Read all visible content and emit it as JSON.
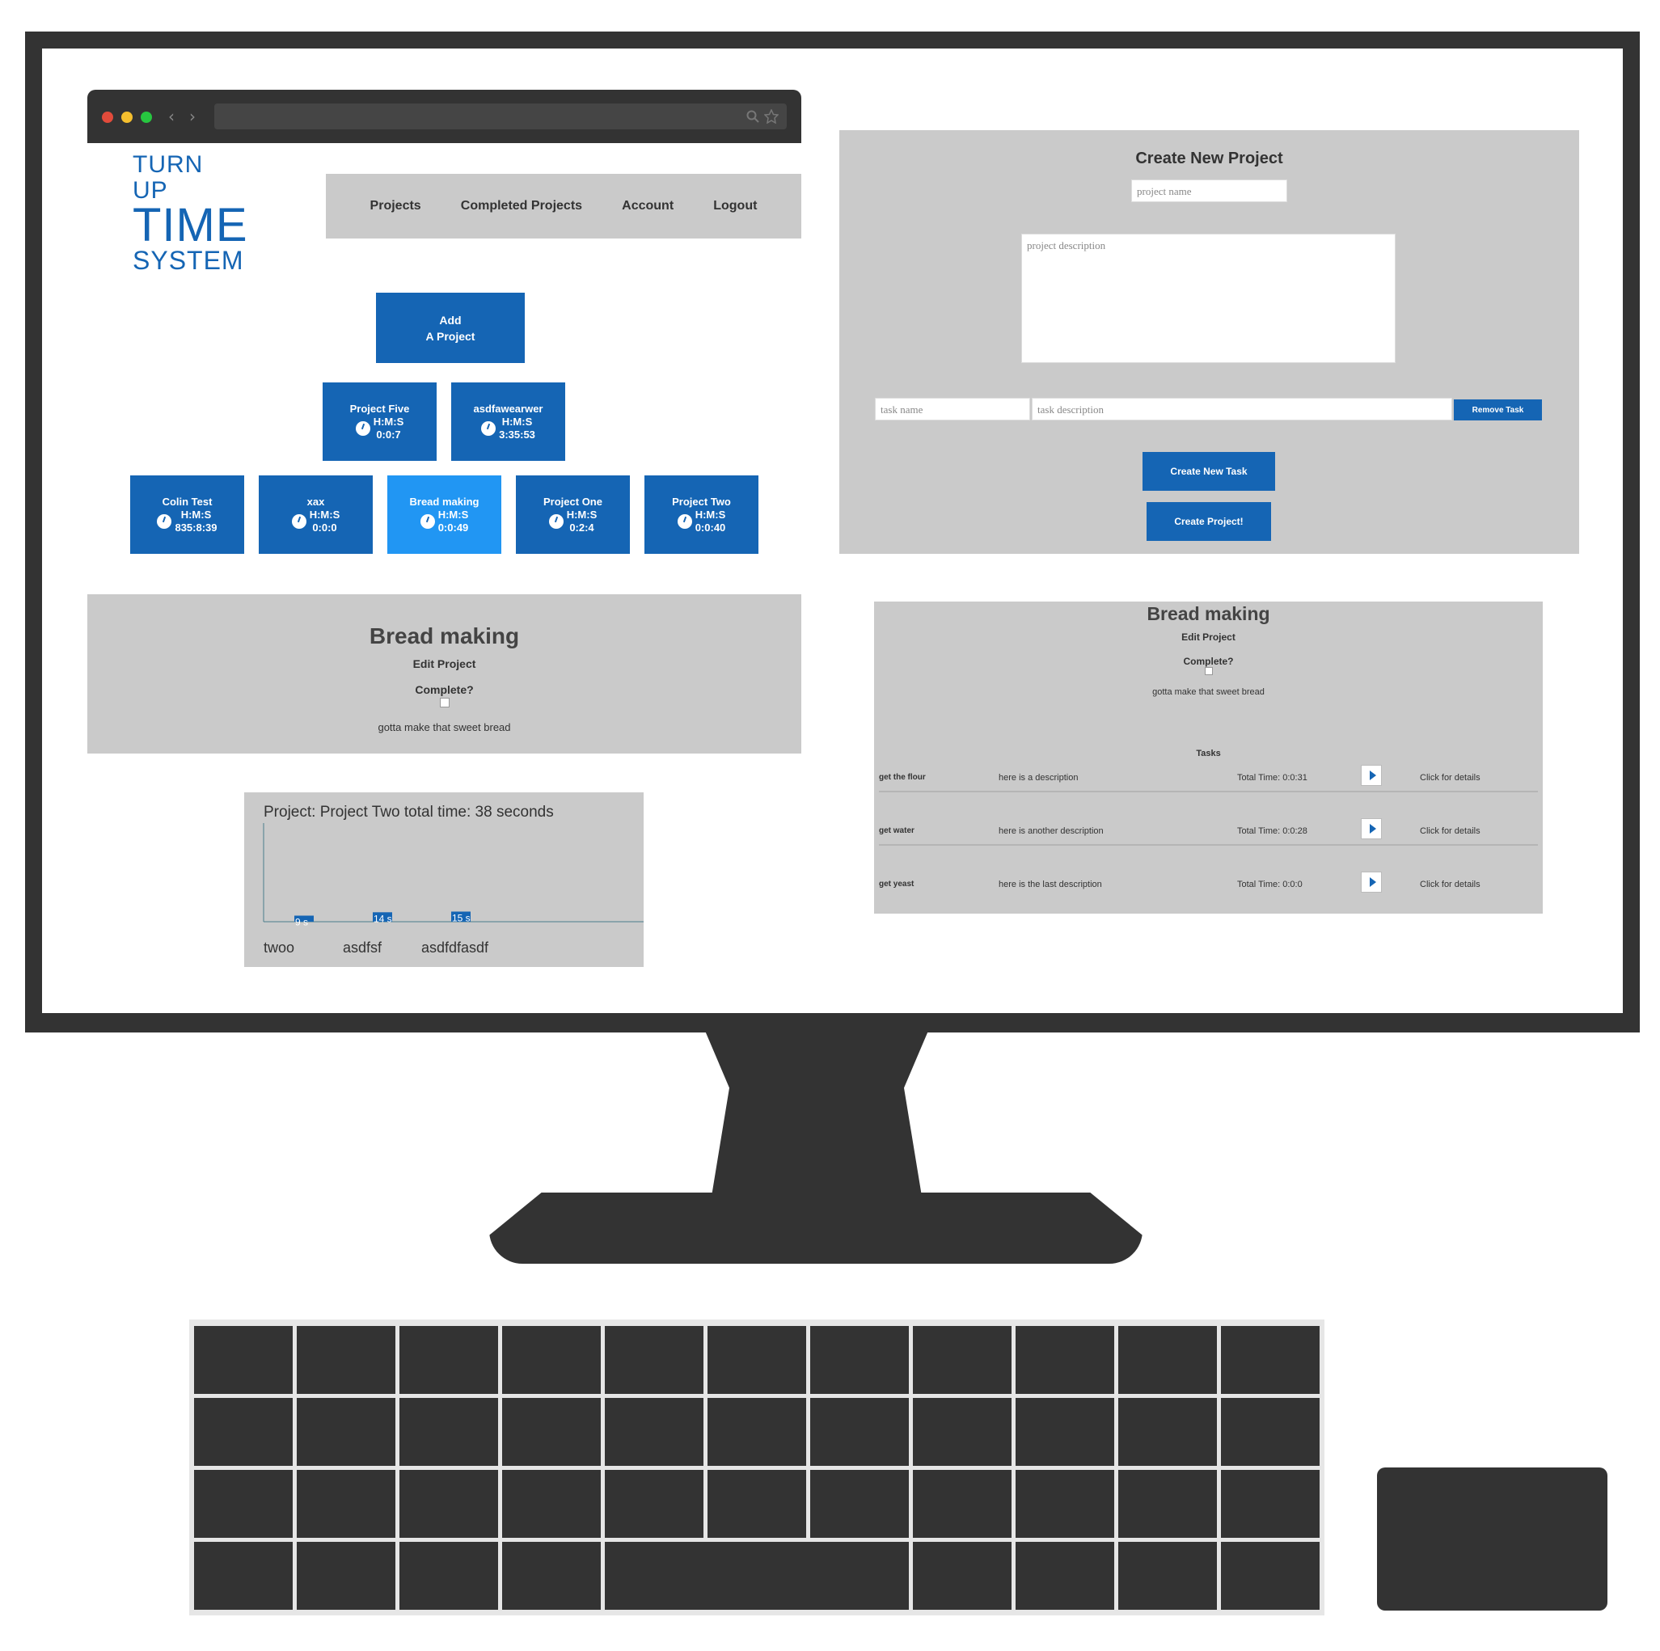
{
  "browser": {
    "colors": {
      "close": "#e24b3b",
      "minimize": "#f5bf2e",
      "maximize": "#27c640"
    }
  },
  "logo": {
    "line1": "TURN UP",
    "line2": "TIME",
    "line3": "SYSTEM"
  },
  "nav": {
    "items": [
      "Projects",
      "Completed Projects",
      "Account",
      "Logout"
    ]
  },
  "add_project": {
    "line1": "Add",
    "line2": "A Project"
  },
  "hms_label": "H:M:S",
  "projects_row1": [
    {
      "name": "Project Five",
      "time": "0:0:7",
      "active": false
    },
    {
      "name": "asdfawearwer",
      "time": "3:35:53",
      "active": false
    }
  ],
  "projects_row2": [
    {
      "name": "Colin Test",
      "time": "835:8:39",
      "active": false
    },
    {
      "name": "xax",
      "time": "0:0:0",
      "active": false
    },
    {
      "name": "Bread making",
      "time": "0:0:49",
      "active": true
    },
    {
      "name": "Project One",
      "time": "0:2:4",
      "active": false
    },
    {
      "name": "Project Two",
      "time": "0:0:40",
      "active": false
    }
  ],
  "detail_left": {
    "title": "Bread making",
    "edit": "Edit Project",
    "complete": "Complete?",
    "description": "gotta make that sweet bread"
  },
  "chart_data": {
    "type": "bar",
    "title": "Project: Project Two total time: 38 seconds",
    "categories": [
      "twoo",
      "asdfsf",
      "asdfdfasdf"
    ],
    "values": [
      9,
      14,
      15
    ],
    "value_labels": [
      "9 s",
      "14 s",
      "15 s"
    ],
    "ylim": [
      0,
      38
    ],
    "bar_color": "#1565b4"
  },
  "create_project": {
    "title": "Create New Project",
    "name_placeholder": "project name",
    "desc_placeholder": "project description",
    "task_name_placeholder": "task name",
    "task_desc_placeholder": "task description",
    "remove_task": "Remove Task",
    "new_task": "Create New Task",
    "create": "Create Project!"
  },
  "detail_right": {
    "title": "Bread making",
    "edit": "Edit Project",
    "complete": "Complete?",
    "description": "gotta make that sweet bread",
    "tasks_label": "Tasks",
    "tasks": [
      {
        "name": "get the flour",
        "description": "here is a description",
        "total": "Total Time: 0:0:31",
        "details": "Click for details"
      },
      {
        "name": "get water",
        "description": "here is another description",
        "total": "Total Time: 0:0:28",
        "details": "Click for details"
      },
      {
        "name": "get yeast",
        "description": "here is the last description",
        "total": "Total Time: 0:0:0",
        "details": "Click for details"
      }
    ]
  },
  "colors": {
    "accent": "#1565b4",
    "active": "#2196f3",
    "panel": "#cacaca",
    "frame": "#333333"
  }
}
